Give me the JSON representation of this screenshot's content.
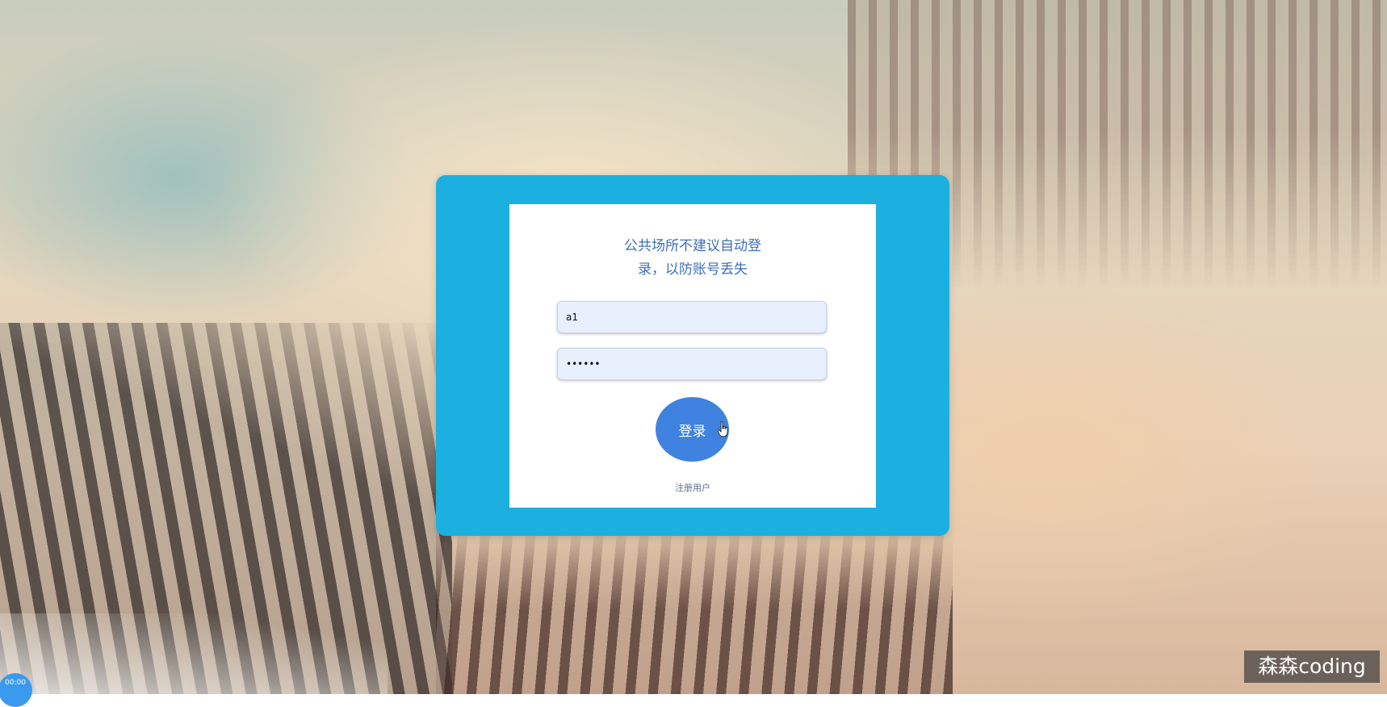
{
  "login": {
    "notice_line1": "公共场所不建议自动登",
    "notice_line2": "录，以防账号丢失",
    "username_value": "a1",
    "password_value": "123456",
    "login_label": "登录",
    "register_label": "注册用户"
  },
  "overlay": {
    "watermark_text": "森森coding",
    "timer_text": "00:00"
  },
  "colors": {
    "outer_card": "#1bb0e0",
    "button": "#3f82e0",
    "notice_text": "#3d6fb8"
  },
  "icons": {
    "cursor": "hand-pointer-icon"
  }
}
